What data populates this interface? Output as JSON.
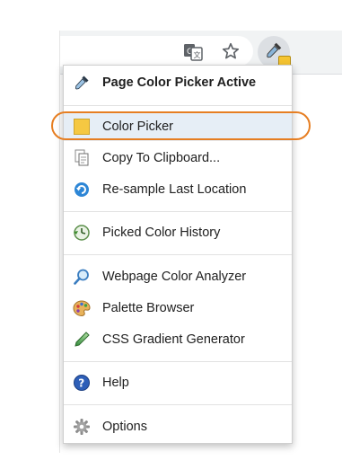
{
  "menu": {
    "header": "Page Color Picker Active",
    "items": [
      {
        "label": "Color Picker"
      },
      {
        "label": "Copy To Clipboard..."
      },
      {
        "label": "Re-sample Last Location"
      },
      {
        "label": "Picked Color History"
      },
      {
        "label": "Webpage Color Analyzer"
      },
      {
        "label": "Palette Browser"
      },
      {
        "label": "CSS Gradient Generator"
      },
      {
        "label": "Help"
      },
      {
        "label": "Options"
      }
    ]
  },
  "colors": {
    "swatch": "#f5c842",
    "highlight": "#e67e22",
    "selected_bg": "#e6eef6"
  },
  "icons": {
    "translate": "translate-icon",
    "star": "star-icon",
    "extension": "eyedropper-icon"
  }
}
